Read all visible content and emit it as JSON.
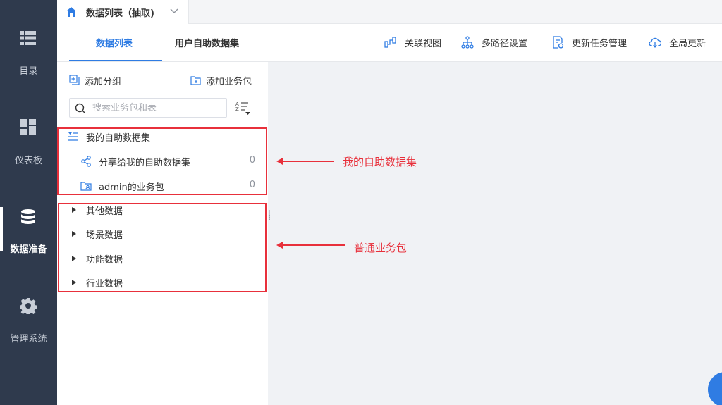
{
  "leftnav": {
    "items": [
      {
        "label": "目录",
        "icon": "catalog-icon"
      },
      {
        "label": "仪表板",
        "icon": "dashboard-icon"
      },
      {
        "label": "数据准备",
        "icon": "database-icon",
        "active": true
      },
      {
        "label": "管理系统",
        "icon": "gear-icon"
      }
    ]
  },
  "doc_tab": {
    "title": "数据列表（抽取)"
  },
  "subtabs": [
    {
      "label": "数据列表",
      "active": true
    },
    {
      "label": "用户自助数据集"
    }
  ],
  "toolbar": {
    "relation_view": "关联视图",
    "multipath": "多路径设置",
    "update_task": "更新任务管理",
    "global_update": "全局更新"
  },
  "panel": {
    "add_group": "添加分组",
    "add_package": "添加业务包",
    "search_placeholder": "搜索业务包和表"
  },
  "tree": {
    "self_service": {
      "label": "我的自助数据集",
      "children": [
        {
          "label": "分享给我的自助数据集",
          "count": "0"
        },
        {
          "label": "admin的业务包",
          "count": "0"
        }
      ]
    },
    "packages": [
      {
        "label": "其他数据"
      },
      {
        "label": "场景数据"
      },
      {
        "label": "功能数据"
      },
      {
        "label": "行业数据"
      }
    ]
  },
  "annotations": {
    "self_service": "我的自助数据集",
    "normal_packages": "普通业务包"
  },
  "colors": {
    "accent": "#2f7ce3",
    "nav_bg": "#2f3a4d",
    "annotation": "#e8303b"
  }
}
